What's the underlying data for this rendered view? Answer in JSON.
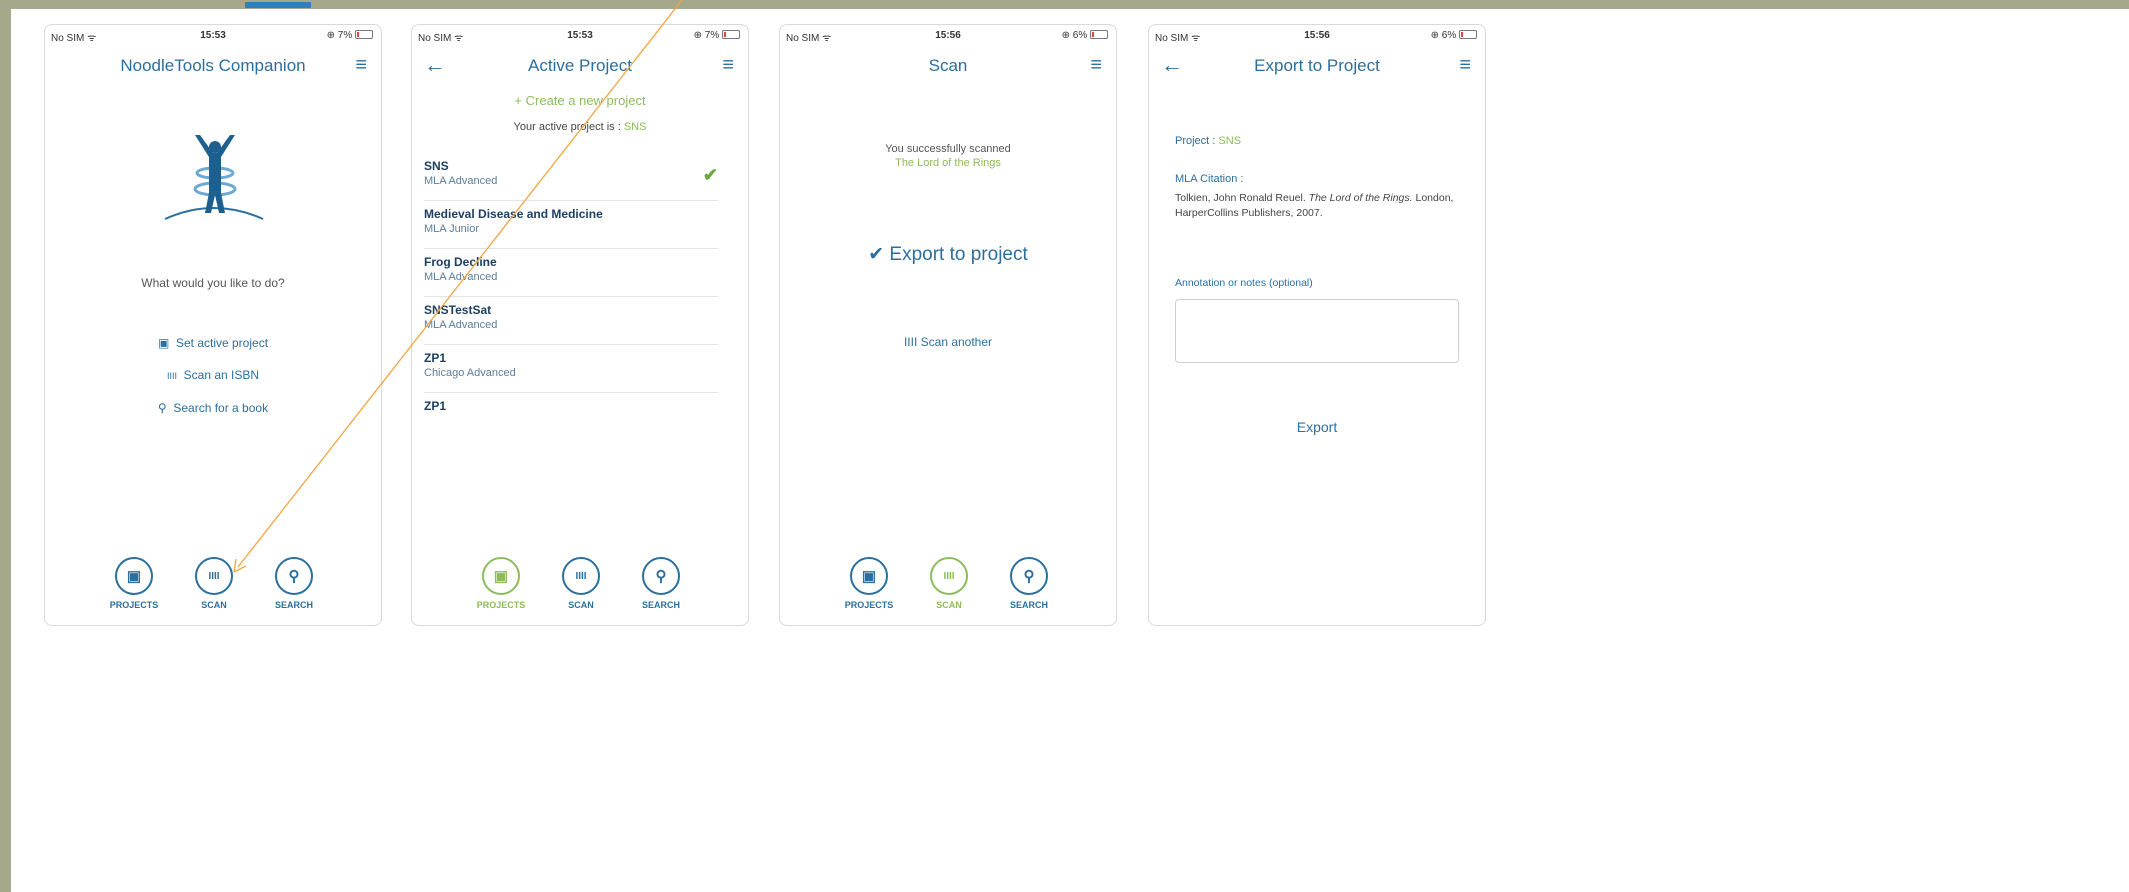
{
  "status_bar": {
    "carrier": "No SIM ᯤ"
  },
  "screens": [
    {
      "time": "15:53",
      "battery": "7%",
      "title": "NoodleTools Companion",
      "prompt": "What would you like to do?",
      "actions": [
        {
          "icon": "▣",
          "label": "Set active project"
        },
        {
          "icon": "IIII",
          "label": "Scan an ISBN"
        },
        {
          "icon": "⚲",
          "label": "Search for a book"
        }
      ]
    },
    {
      "time": "15:53",
      "battery": "7%",
      "title": "Active Project",
      "create_label": "+ Create a new project",
      "active_prefix": "Your active project is :",
      "active_value": "SNS",
      "projects": [
        {
          "name": "SNS",
          "sub": "MLA Advanced",
          "checked": true
        },
        {
          "name": "Medieval Disease and Medicine",
          "sub": "MLA Junior"
        },
        {
          "name": "Frog Decline",
          "sub": "MLA Advanced"
        },
        {
          "name": "SNSTestSat",
          "sub": "MLA Advanced"
        },
        {
          "name": "ZP1",
          "sub": "Chicago Advanced"
        },
        {
          "name": "ZP1",
          "sub": ""
        }
      ]
    },
    {
      "time": "15:56",
      "battery": "6%",
      "title": "Scan",
      "success_text": "You successfully scanned",
      "book_title": "The Lord of the Rings",
      "export_label": "✔ Export to project",
      "scan_another_label": "IIII Scan another"
    },
    {
      "time": "15:56",
      "battery": "6%",
      "title": "Export to Project",
      "project_prefix": "Project :",
      "project_value": "SNS",
      "citation_label": "MLA Citation :",
      "citation_author": "Tolkien, John Ronald Reuel.",
      "citation_title": "The Lord of the Rings.",
      "citation_rest": "London, HarperCollins Publishers, 2007.",
      "notes_label": "Annotation or notes (optional)",
      "export_button": "Export"
    }
  ],
  "tabs": [
    {
      "icon": "▣",
      "label": "PROJECTS"
    },
    {
      "icon": "IIII",
      "label": "SCAN"
    },
    {
      "icon": "⚲",
      "label": "SEARCH"
    }
  ],
  "icons": {
    "menu": "≡",
    "back": "←",
    "check": "✔",
    "battery_symbol": "⊕"
  },
  "colors": {
    "accent_blue": "#2b6f9e",
    "accent_green": "#8cbc5b",
    "arrow": "#f2a541"
  }
}
